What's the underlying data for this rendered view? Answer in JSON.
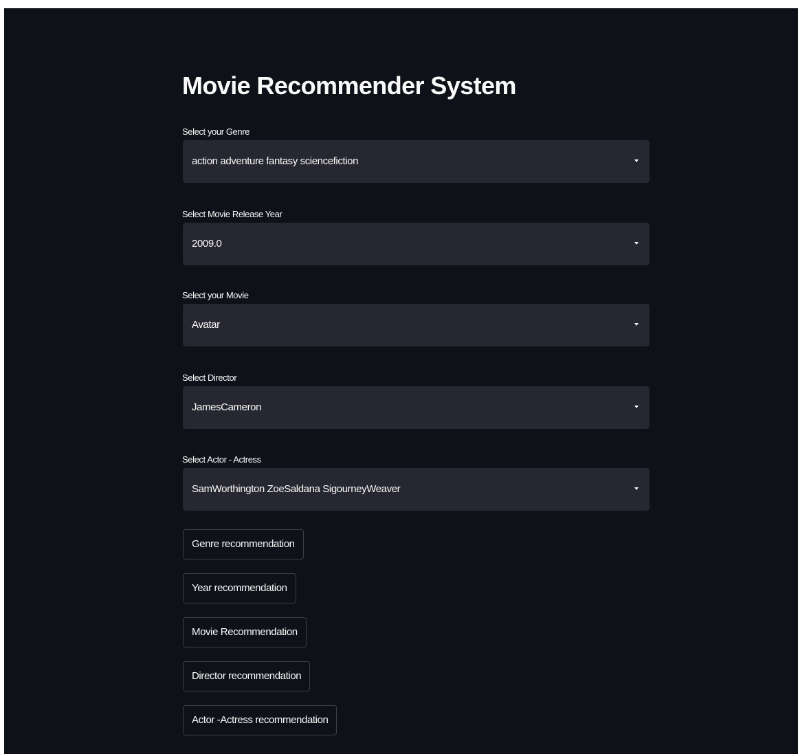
{
  "page": {
    "title": "Movie Recommender System"
  },
  "fields": {
    "genre": {
      "label": "Select your Genre",
      "value": "action adventure fantasy sciencefiction"
    },
    "year": {
      "label": "Select Movie Release Year",
      "value": "2009.0"
    },
    "movie": {
      "label": "Select your Movie",
      "value": "Avatar"
    },
    "director": {
      "label": "Select Director",
      "value": "JamesCameron"
    },
    "actor": {
      "label": "Select Actor - Actress",
      "value": "SamWorthington ZoeSaldana SigourneyWeaver"
    }
  },
  "buttons": {
    "genre": "Genre recommendation",
    "year": "Year recommendation",
    "movie": "Movie Recommendation",
    "director": "Director recommendation",
    "actor": "Actor -Actress recommendation"
  },
  "icons": {
    "select_caret": "chevron-down-icon"
  },
  "colors": {
    "background": "#0e1117",
    "select_background": "#262730",
    "text": "#fafafa",
    "button_border": "rgba(250,250,250,0.2)"
  }
}
